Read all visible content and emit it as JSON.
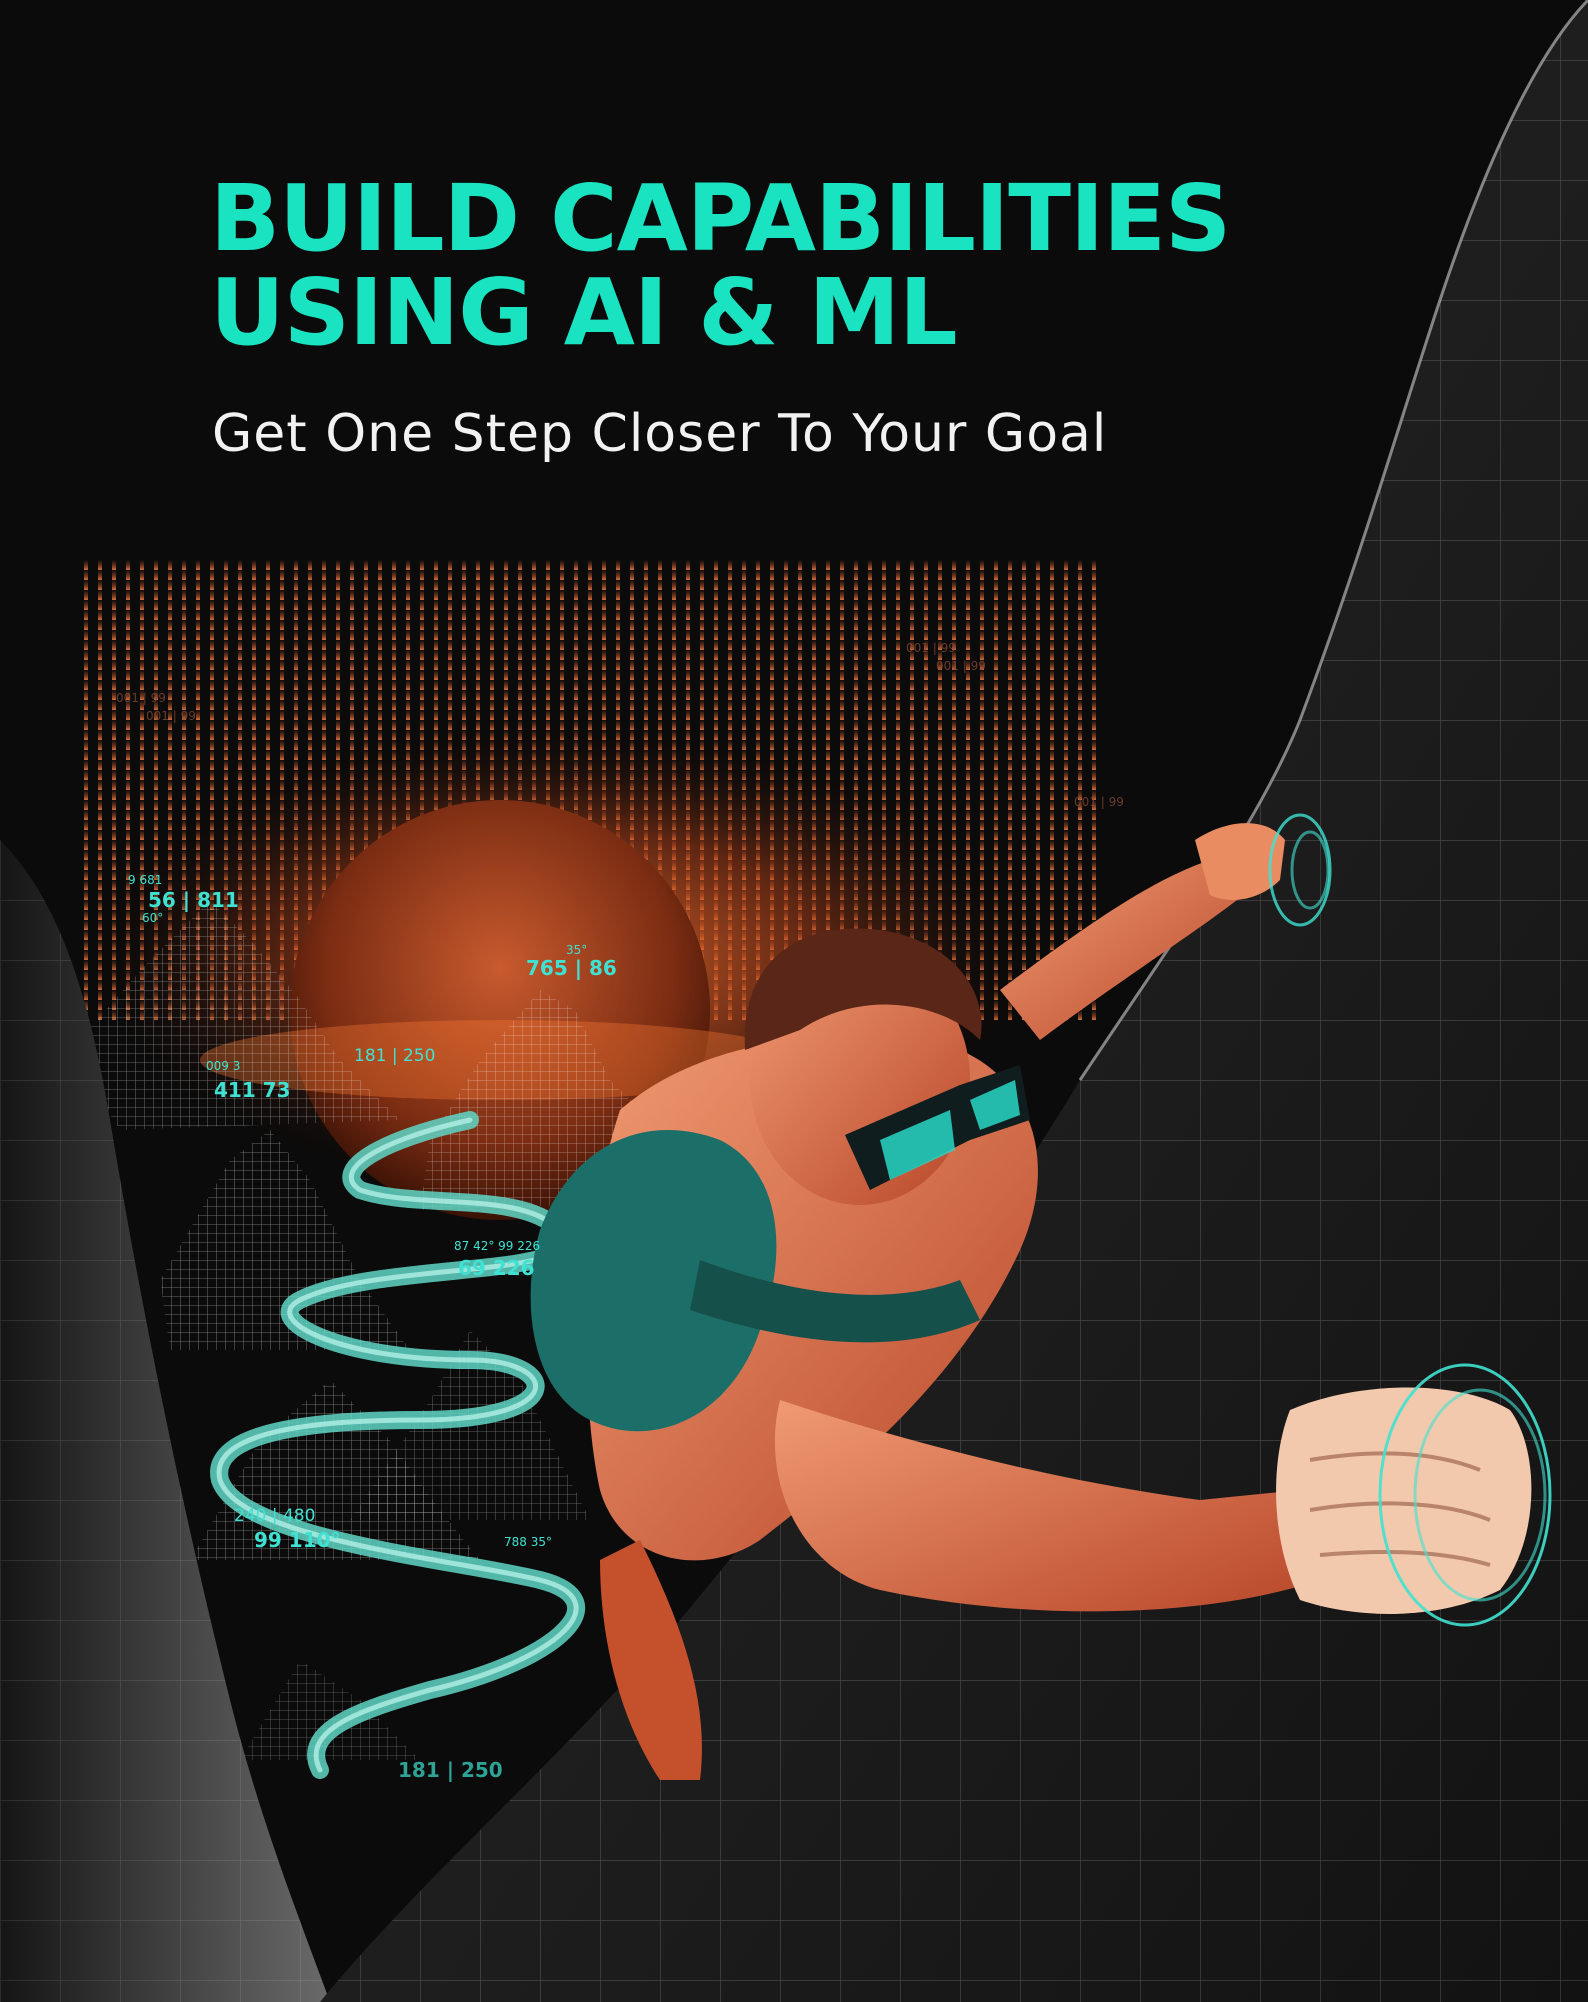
{
  "colors": {
    "accent_teal": "#19e3c0",
    "text_white": "#f2f2f2",
    "sunset_orange": "#e0662e",
    "background": "#0b0b0b",
    "hud_cyan": "#3fe2d2"
  },
  "headline": {
    "line1": "BUILD CAPABILITIES",
    "line2": "USING AI & ML"
  },
  "subtitle": "Get One Step Closer To Your Goal",
  "hud_labels": [
    {
      "text": "001 | 99"
    },
    {
      "text": "001 | 99"
    },
    {
      "text": "001 | 99"
    },
    {
      "text": "001 | 99"
    },
    {
      "text": "001 | 99"
    },
    {
      "text": "9  681"
    },
    {
      "text": "56  |  811"
    },
    {
      "text": "60°"
    },
    {
      "text": "35°"
    },
    {
      "text": "765 | 86"
    },
    {
      "text": "181 | 250"
    },
    {
      "text": "009   3"
    },
    {
      "text": "411   73"
    },
    {
      "text": "87  42°   99  226"
    },
    {
      "text": "69    226"
    },
    {
      "text": "240 | 480"
    },
    {
      "text": "99    110°"
    },
    {
      "text": "788  35°"
    },
    {
      "text": "181 | 250"
    }
  ],
  "icons": [
    "sun-icon",
    "mountain-icon",
    "climber-icon",
    "grip-ripple-icon"
  ]
}
